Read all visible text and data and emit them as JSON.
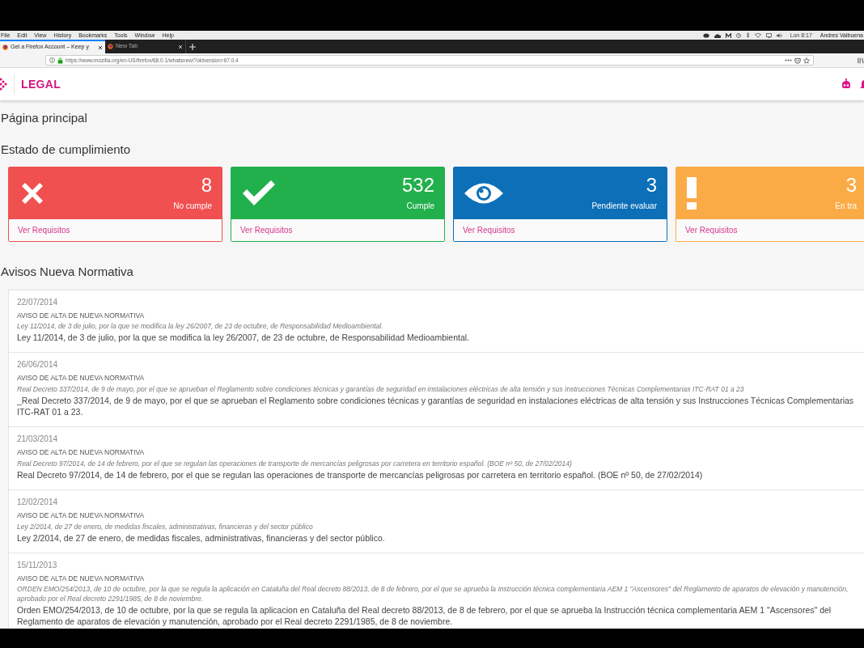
{
  "menu_bar": {
    "items": [
      "File",
      "Edit",
      "View",
      "History",
      "Bookmarks",
      "Tools",
      "Window",
      "Help"
    ],
    "clock": "Lun 8:17",
    "user": "Andres Valbuena"
  },
  "browser": {
    "tabs": [
      {
        "title": "Get a Firefox Account – Keep y",
        "selected": true
      },
      {
        "title": "New Tab",
        "selected": false
      }
    ],
    "url": "https://www.mozilla.org/en-US/firefox/68.0.1/whatsnew/?oldversion=67.0.4"
  },
  "app": {
    "logo": "LEGAL"
  },
  "page_title": "Página principal",
  "status_title": "Estado de cumplimiento",
  "status_cards": [
    {
      "kind": "cross",
      "color": "#f0504f",
      "count": "8",
      "label": "No cumple",
      "link": "Ver Requisitos"
    },
    {
      "kind": "check",
      "color": "#22b04c",
      "count": "532",
      "label": "Cumple",
      "link": "Ver Requisitos"
    },
    {
      "kind": "eye",
      "color": "#0c6fb8",
      "count": "3",
      "label": "Pendiente evaluar",
      "link": "Ver Requisitos"
    },
    {
      "kind": "exclamation",
      "color": "#fbab46",
      "count": "3",
      "label": "En tra",
      "link": "Ver Requisitos"
    }
  ],
  "notices_title": "Avisos Nueva Normativa",
  "notices": [
    {
      "date": "22/07/2014",
      "heading": "AVISO DE ALTA DE NUEVA NORMATIVA",
      "summary": "Ley 11/2014, de 3 de julio, por la que se modifica la ley 26/2007, de 23 de octubre, de Responsabilidad Medioambiental.",
      "text": "Ley 11/2014, de 3 de julio, por la que se modifica la ley 26/2007, de 23 de octubre, de Responsabilidad Medioambiental."
    },
    {
      "date": "26/06/2014",
      "heading": "AVISO DE ALTA DE NUEVA NORMATIVA",
      "summary": "Real Decreto 337/2014, de 9 de mayo, por el que se aprueban el Reglamento sobre condiciones técnicas y garantías de seguridad en instalaciones eléctricas de alta tensión y sus Instrucciones Técnicas Complementarias ITC-RAT 01 a 23",
      "text": "_Real Decreto 337/2014, de 9 de mayo, por el que se aprueban el Reglamento sobre condiciones técnicas y garantías de seguridad en instalaciones eléctricas de alta tensión y sus Instrucciones Técnicas Complementarias ITC-RAT 01 a 23."
    },
    {
      "date": "21/03/2014",
      "heading": "AVISO DE ALTA DE NUEVA NORMATIVA",
      "summary": "Real Decreto 97/2014, de 14 de febrero, por el que se regulan las operaciones de transporte de mercancías peligrosas por carretera en territorio español. (BOE nº 50, de 27/02/2014)",
      "text": "Real Decreto 97/2014, de 14 de febrero, por el que se regulan las operaciones de transporte de mercancías peligrosas por carretera en territorio español. (BOE nº 50, de 27/02/2014)"
    },
    {
      "date": "12/02/2014",
      "heading": "AVISO DE ALTA DE NUEVA NORMATIVA",
      "summary": "Ley 2/2014, de 27 de enero, de medidas fiscales, administrativas, financieras y del sector público",
      "text": "Ley 2/2014, de 27 de enero, de medidas fiscales, administrativas, financieras y del sector público."
    },
    {
      "date": "15/11/2013",
      "heading": "AVISO DE ALTA DE NUEVA NORMATIVA",
      "summary": "ORDEN EMO/254/2013, de 10 de octubre, por la que se regula la aplicación en Cataluña del Real decreto 88/2013, de 8 de febrero, por el que se aprueba la Instrucción técnica complementaria AEM 1 \"Ascensores\" del Reglamento de aparatos de elevación y manutención, aprobado por el Real decreto 2291/1985, de 8 de noviembre.",
      "text": "Orden EMO/254/2013, de 10 de octubre, por la que se regula la aplicacion en Cataluña del Real decreto 88/2013, de 8 de febrero, por el que se aprueba la Instrucción técnica complementaria AEM 1 \"Ascensores\" del Reglamento de aparatos de elevación y manutención, aprobado por el Real decreto 2291/1985, de 8 de noviembre."
    }
  ]
}
